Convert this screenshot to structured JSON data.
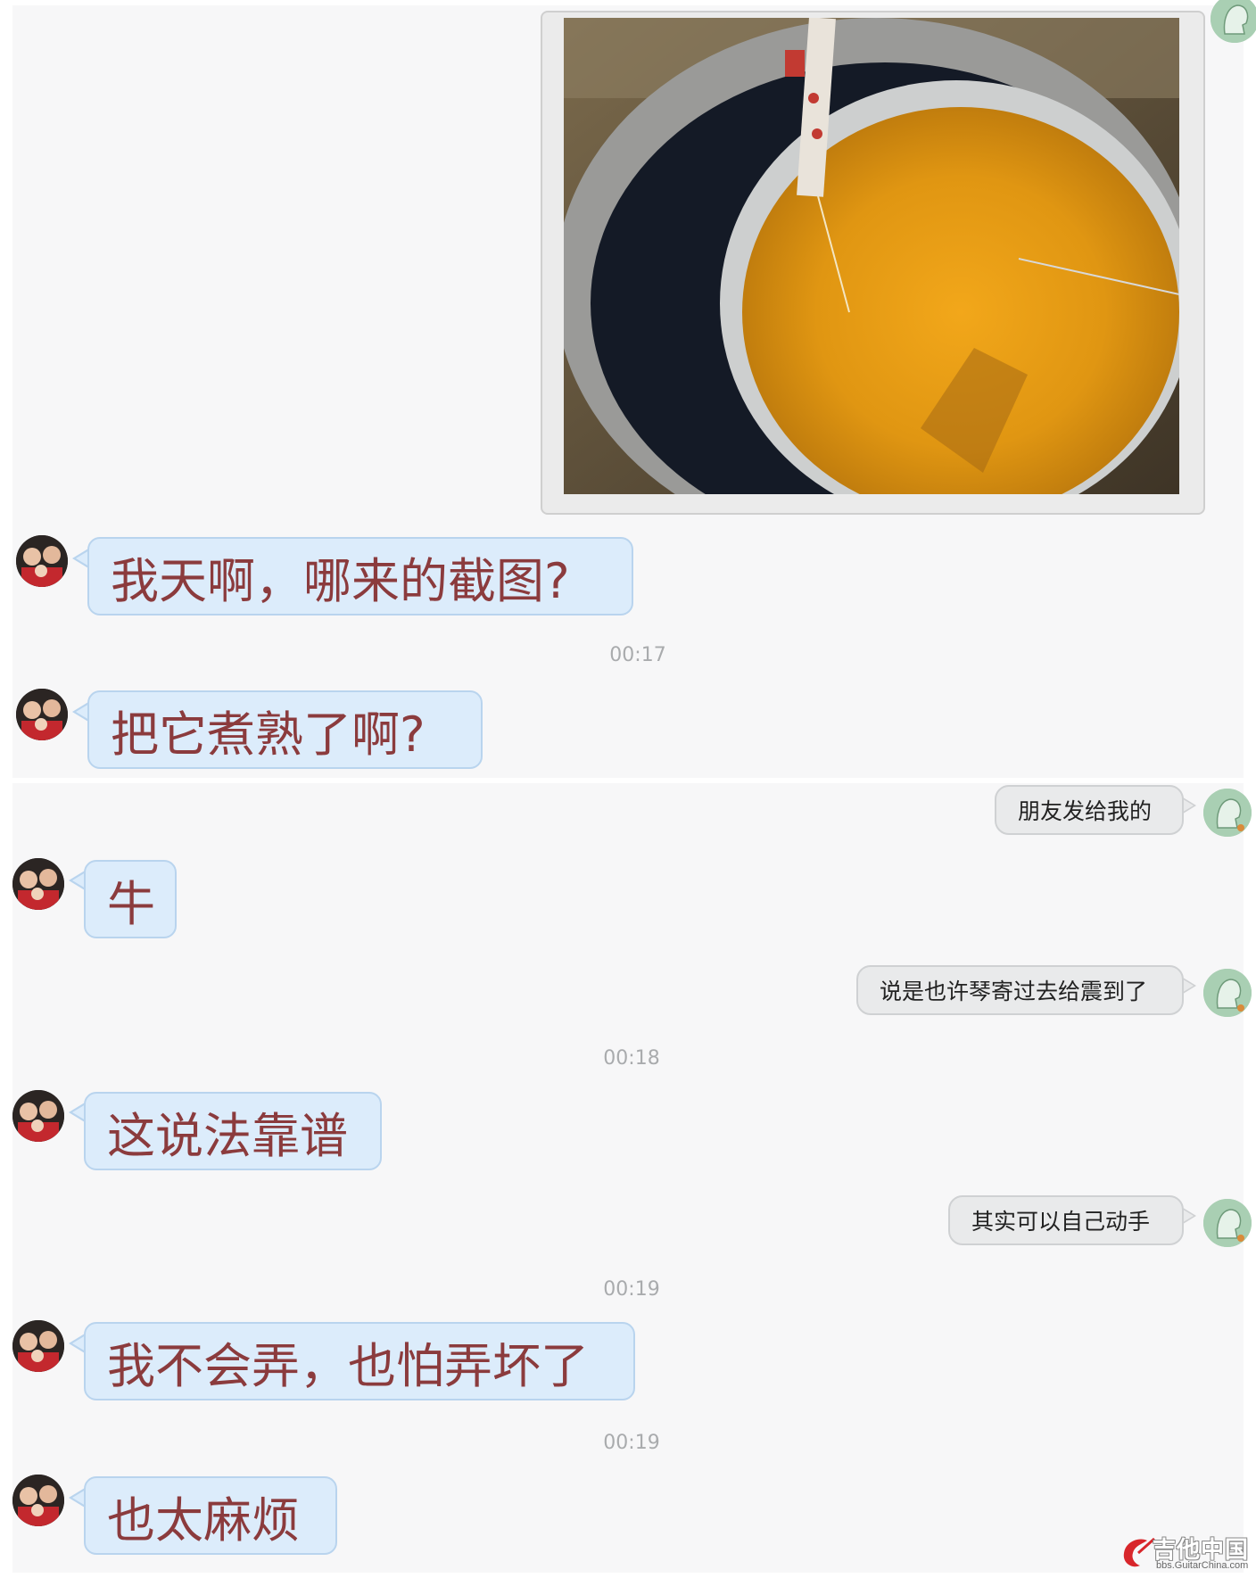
{
  "messages": [
    {
      "side": "out",
      "type": "image"
    },
    {
      "side": "in",
      "text": "我天啊，哪来的截图?"
    },
    {
      "type": "time",
      "text": "00:17"
    },
    {
      "side": "in",
      "text": "把它煮熟了啊?"
    },
    {
      "side": "out",
      "text": "朋友发给我的"
    },
    {
      "side": "in",
      "text": "牛"
    },
    {
      "side": "out",
      "text": "说是也许琴寄过去给震到了"
    },
    {
      "type": "time",
      "text": "00:18"
    },
    {
      "side": "in",
      "text": "这说法靠谱"
    },
    {
      "side": "out",
      "text": "其实可以自己动手"
    },
    {
      "type": "time",
      "text": "00:19"
    },
    {
      "side": "in",
      "text": "我不会弄，也怕弄坏了"
    },
    {
      "type": "time",
      "text": "00:19"
    },
    {
      "side": "in",
      "text": "也太麻烦"
    }
  ],
  "watermark": {
    "title": "吉他中国",
    "url": "bbs.GuitarChina.com"
  },
  "colors": {
    "incoming_bubble": "#dcecfb",
    "incoming_border": "#b9d4ee",
    "incoming_text": "#8b3b3d",
    "outgoing_bubble": "#e9eaeb",
    "outgoing_text": "#222222",
    "timestamp_text": "#a9abad",
    "panel_background": "#f7f7f8"
  },
  "icons": {
    "incoming_avatar": "avatar-photo-icon",
    "outgoing_avatar": "default-avatar-silhouette-icon",
    "watermark_logo": "guitar-logo-icon"
  }
}
